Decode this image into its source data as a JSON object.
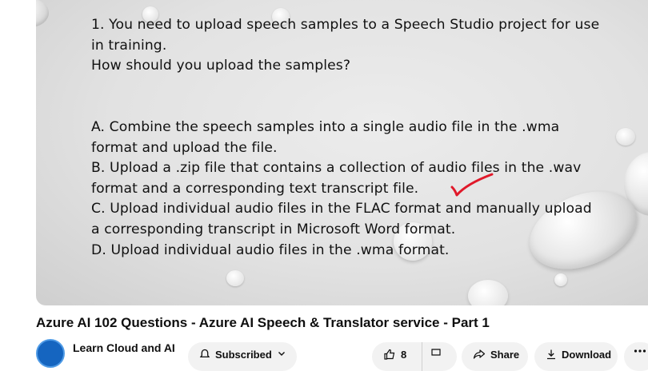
{
  "video": {
    "slide": {
      "question_lines": [
        "1. You need to upload speech samples to a Speech Studio project for use",
        "in training.",
        "How should you upload the samples?"
      ],
      "option_lines": [
        "A. Combine the speech samples into a single audio file in the .wma",
        "format and upload the file.",
        "B. Upload a .zip file that contains a collection of audio files in the .wav",
        "format and a corresponding text transcript file.",
        "C. Upload individual audio files in the FLAC format and manually upload",
        "a corresponding transcript in Microsoft Word format.",
        "D. Upload individual audio files in the .wma format."
      ],
      "checkmark_color": "#e0192a"
    },
    "title": "Azure AI 102 Questions - Azure AI Speech & Translator service - Part 1"
  },
  "channel": {
    "name": "Learn Cloud and AI"
  },
  "actions": {
    "subscribe_label": "Subscribed",
    "like_count": "8",
    "share_label": "Share",
    "download_label": "Download"
  },
  "colors": {
    "pill_background": "#f2f2f2",
    "avatar": "#1565c0"
  }
}
